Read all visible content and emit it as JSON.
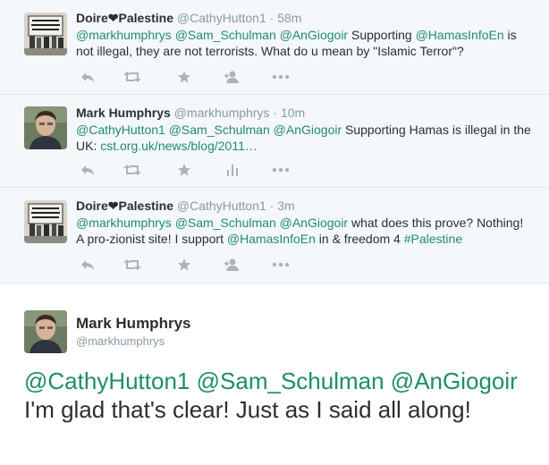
{
  "tweets": [
    {
      "name": "Doire",
      "name_suffix": "Palestine",
      "handle": "@CathyHutton1",
      "time": "58m",
      "parts": [
        {
          "t": "@markhumphrys",
          "link": true
        },
        {
          "t": " ",
          "link": false
        },
        {
          "t": "@Sam_Schulman",
          "link": true
        },
        {
          "t": " ",
          "link": false
        },
        {
          "t": "@AnGiogoir",
          "link": true
        },
        {
          "t": " Supporting ",
          "link": false
        },
        {
          "t": "@HamasInfoEn",
          "link": true
        },
        {
          "t": " is not illegal, they are not terrorists. What do u mean by \"Islamic Terror\"?",
          "link": false
        }
      ],
      "icons": [
        "reply-icon",
        "retweet-icon",
        "favorite-icon",
        "follow-icon",
        "more-icon"
      ]
    },
    {
      "name": "Mark Humphrys",
      "name_suffix": "",
      "handle": "@markhumphrys",
      "time": "10m",
      "parts": [
        {
          "t": "@CathyHutton1",
          "link": true
        },
        {
          "t": " ",
          "link": false
        },
        {
          "t": "@Sam_Schulman",
          "link": true
        },
        {
          "t": " ",
          "link": false
        },
        {
          "t": "@AnGiogoir",
          "link": true
        },
        {
          "t": "  Supporting Hamas is illegal in the UK: ",
          "link": false
        },
        {
          "t": "cst.org.uk/news/blog/2011…",
          "link": true
        }
      ],
      "icons": [
        "reply-icon",
        "retweet-icon",
        "favorite-icon",
        "analytics-icon",
        "more-icon"
      ]
    },
    {
      "name": "Doire",
      "name_suffix": "Palestine",
      "handle": "@CathyHutton1",
      "time": "3m",
      "parts": [
        {
          "t": "@markhumphrys",
          "link": true
        },
        {
          "t": " ",
          "link": false
        },
        {
          "t": "@Sam_Schulman",
          "link": true
        },
        {
          "t": " ",
          "link": false
        },
        {
          "t": "@AnGiogoir",
          "link": true
        },
        {
          "t": " what does this prove? Nothing! A pro-zionist site! I support ",
          "link": false
        },
        {
          "t": "@HamasInfoEn",
          "link": true
        },
        {
          "t": " in & freedom 4 ",
          "link": false
        },
        {
          "t": "#Palestine",
          "link": true
        }
      ],
      "icons": [
        "reply-icon",
        "retweet-icon",
        "favorite-icon",
        "follow-icon",
        "more-icon"
      ]
    }
  ],
  "main_tweet": {
    "name": "Mark Humphrys",
    "handle": "@markhumphrys",
    "parts": [
      {
        "t": "@CathyHutton1",
        "link": true
      },
      {
        "t": " ",
        "link": false
      },
      {
        "t": "@Sam_Schulman",
        "link": true
      },
      {
        "t": " ",
        "link": false
      },
      {
        "t": "@AnGiogoir",
        "link": true
      },
      {
        "t": "  I'm glad that's clear! Just as I said all along!",
        "link": false
      }
    ]
  },
  "colors": {
    "link": "#1f8c6a",
    "icon": "#a8b4be",
    "meta": "#8899a6",
    "bg": "#f5f8fa"
  }
}
